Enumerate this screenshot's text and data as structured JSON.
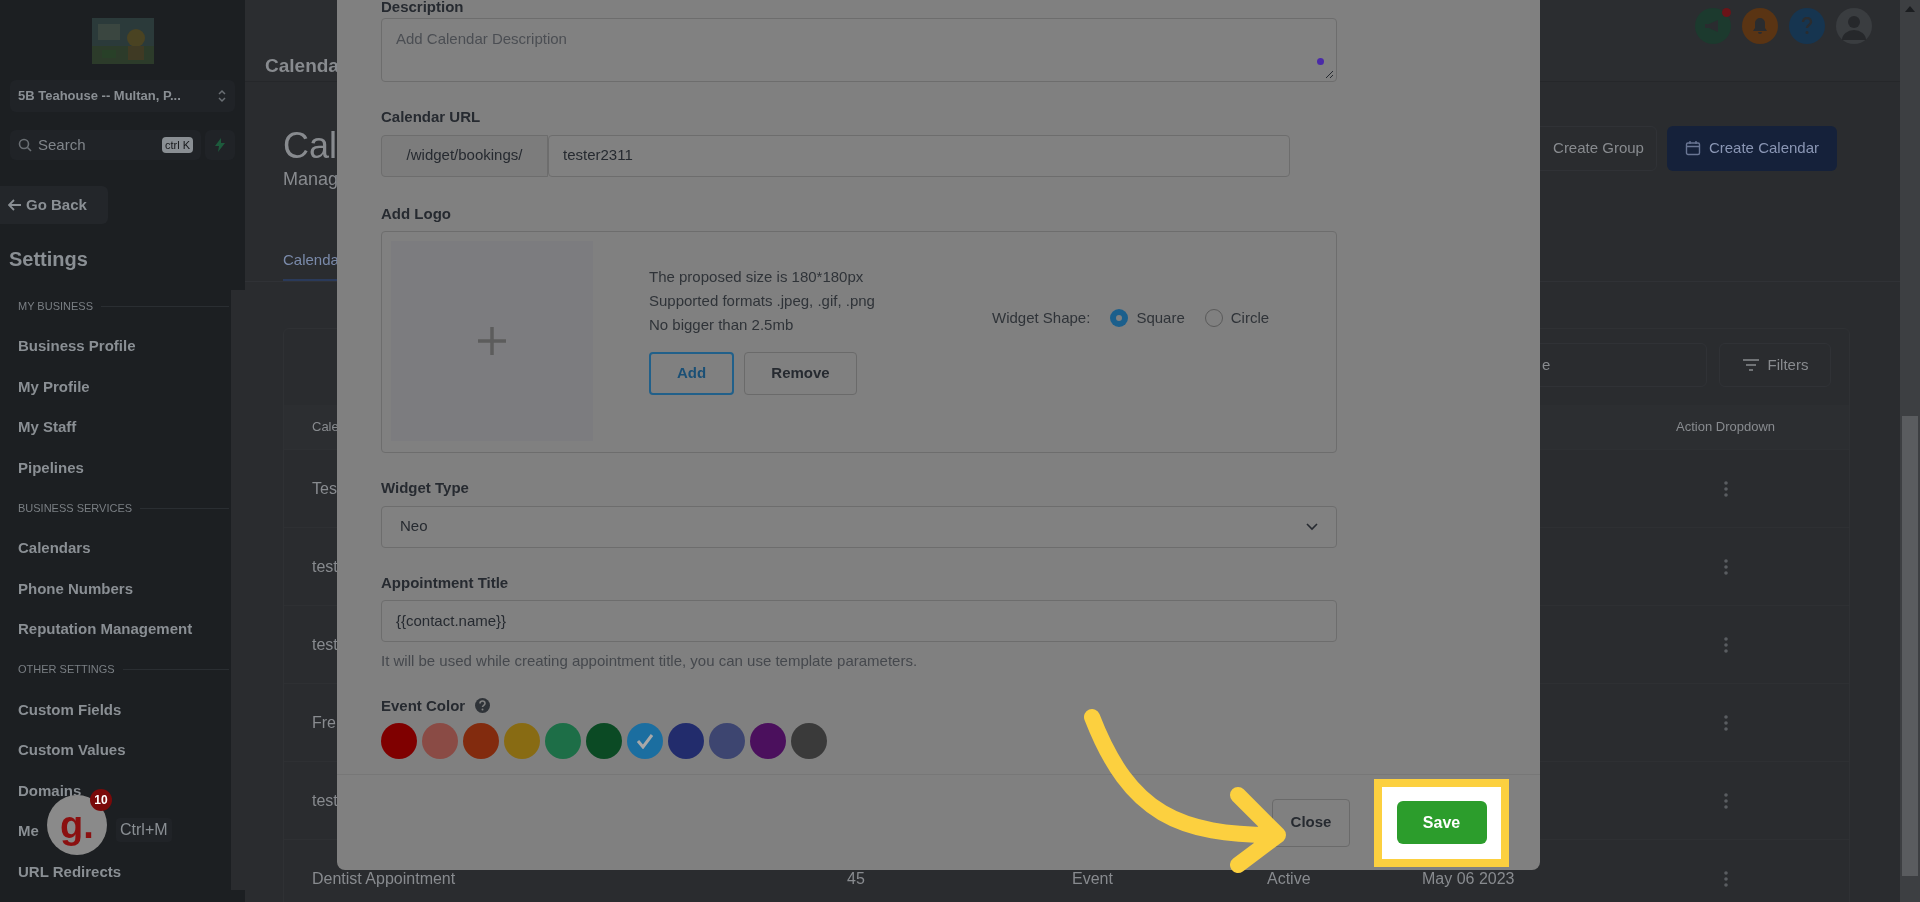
{
  "sidebar": {
    "location": "5B Teahouse -- Multan, P...",
    "search": {
      "placeholder": "Search",
      "shortcut": "ctrl K"
    },
    "back": "Go Back",
    "title": "Settings",
    "sections": [
      {
        "heading": "MY BUSINESS",
        "items": [
          "Business Profile",
          "My Profile",
          "My Staff",
          "Pipelines"
        ]
      },
      {
        "heading": "BUSINESS SERVICES",
        "items": [
          "Calendars",
          "Phone Numbers",
          "Reputation Management"
        ]
      },
      {
        "heading": "OTHER SETTINGS",
        "items": [
          "Custom Fields",
          "Custom Values",
          "Domains",
          "Me",
          "URL Redirects"
        ]
      }
    ]
  },
  "assistant_badge": {
    "logo": "g.",
    "count": "10",
    "shortcut": "Ctrl+M"
  },
  "header": {
    "title": "Calenda"
  },
  "page": {
    "heading": "Cal",
    "subheading": "Manag",
    "buttons": [
      {
        "kind": "outline",
        "label": "Create Group"
      },
      {
        "kind": "primary",
        "label": "Create Calendar"
      }
    ],
    "tabs": [
      {
        "label": "Calenda"
      }
    ],
    "search": {
      "placeholder": "e"
    },
    "filters": "Filters",
    "table": {
      "columns": [
        "Cale",
        "",
        "",
        "",
        "",
        "Action Dropdown"
      ],
      "rows": [
        {
          "cells": [
            "Tes"
          ]
        },
        {
          "cells": [
            "test"
          ]
        },
        {
          "cells": [
            "test"
          ]
        },
        {
          "cells": [
            "Fre"
          ]
        },
        {
          "cells": [
            "test"
          ]
        },
        {
          "cells": [
            "Dentist Appointment",
            "45",
            "Event",
            "Active",
            "May 06 2023"
          ]
        }
      ]
    }
  },
  "modal": {
    "description": {
      "label": "Description",
      "placeholder": "Add Calendar Description"
    },
    "url": {
      "label": "Calendar URL",
      "prefix": "/widget/bookings/",
      "value": "tester2311"
    },
    "logo": {
      "label": "Add Logo",
      "notes": [
        "The proposed size is 180*180px",
        "Supported formats .jpeg, .gif, .png",
        "No bigger than 2.5mb"
      ],
      "buttons": [
        {
          "kind": "outline-blue",
          "label": "Add"
        },
        {
          "kind": "outline",
          "label": "Remove"
        }
      ],
      "shape": {
        "label": "Widget Shape:",
        "options": [
          {
            "label": "Square",
            "selected": true
          },
          {
            "label": "Circle",
            "selected": false
          }
        ]
      }
    },
    "widget_type": {
      "label": "Widget Type",
      "value": "Neo"
    },
    "appointment_title": {
      "label": "Appointment Title",
      "value": "{{contact.name}}",
      "help": "It will be used while creating appointment title, you can use template parameters."
    },
    "event_color": {
      "label": "Event Color",
      "colors": [
        {
          "color": "#7f0000",
          "selected": false
        },
        {
          "color": "#8a4b45",
          "selected": false
        },
        {
          "color": "#822b0e",
          "selected": false
        },
        {
          "color": "#886b13",
          "selected": false
        },
        {
          "color": "#1d6e47",
          "selected": false
        },
        {
          "color": "#0b4a24",
          "selected": false
        },
        {
          "color": "#1b6ea0",
          "selected": true
        },
        {
          "color": "#222c6c",
          "selected": false
        },
        {
          "color": "#3d4570",
          "selected": false
        },
        {
          "color": "#4b105d",
          "selected": false
        },
        {
          "color": "#3a3a3a",
          "selected": false
        }
      ]
    },
    "footer": {
      "close": "Close",
      "save": "Save"
    }
  }
}
